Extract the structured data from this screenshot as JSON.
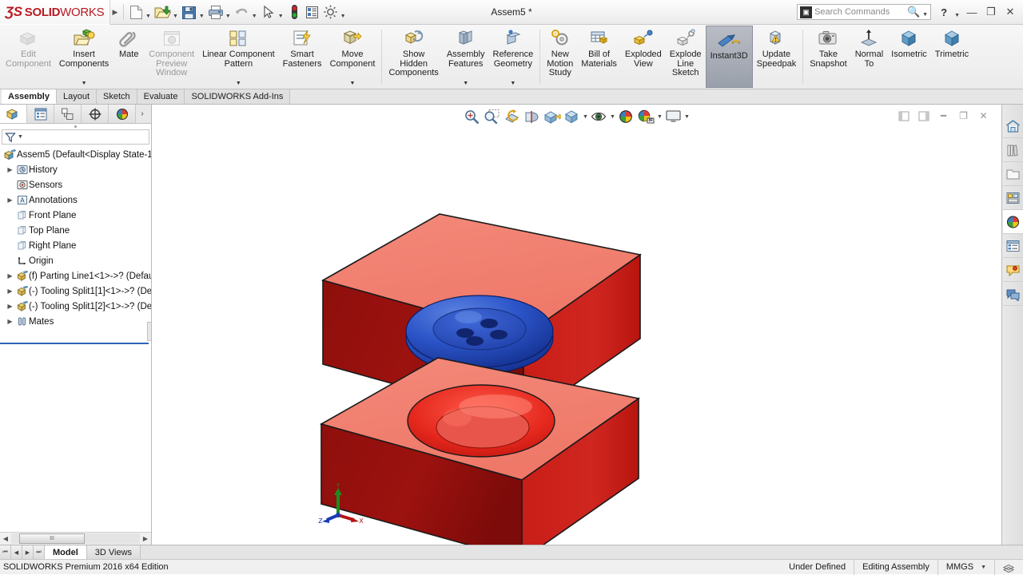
{
  "titlebar": {
    "logo_ds": "ƷS",
    "logo_bold": "SOLID",
    "logo_light": "WORKS",
    "document_title": "Assem5 *",
    "quick_access": [
      {
        "name": "new-document",
        "label": "New",
        "icon": "page-icon"
      },
      {
        "name": "open-document",
        "label": "Open",
        "icon": "folder-open-icon"
      },
      {
        "name": "save-document",
        "label": "Save",
        "icon": "floppy-disk-icon"
      },
      {
        "name": "print-document",
        "label": "Print",
        "icon": "printer-icon"
      },
      {
        "name": "undo",
        "label": "Undo",
        "icon": "undo-arrow-icon"
      },
      {
        "name": "select",
        "label": "Select",
        "icon": "cursor-arrow-icon"
      },
      {
        "name": "rebuild",
        "label": "Rebuild",
        "icon": "traffic-light-icon"
      },
      {
        "name": "options-display",
        "label": "File Properties",
        "icon": "properties-icon"
      },
      {
        "name": "options",
        "label": "Options",
        "icon": "gear-icon"
      }
    ],
    "search_placeholder": "Search Commands",
    "help_label": "?",
    "minimize_label": "—",
    "restore_label": "❐",
    "close_label": "✕"
  },
  "ribbon": {
    "groups": [
      {
        "items": [
          {
            "name": "edit-component",
            "label": "Edit\nComponent",
            "icon": "edit-component-icon",
            "disabled": true,
            "dropdown": false,
            "active": false
          },
          {
            "name": "insert-components",
            "label": "Insert\nComponents",
            "icon": "insert-components-icon",
            "disabled": false,
            "dropdown": true,
            "active": false
          },
          {
            "name": "mate",
            "label": "Mate",
            "icon": "paperclip-icon",
            "disabled": false,
            "dropdown": false,
            "active": false
          },
          {
            "name": "component-preview-window",
            "label": "Component\nPreview\nWindow",
            "icon": "preview-window-icon",
            "disabled": true,
            "dropdown": false,
            "active": false
          },
          {
            "name": "linear-component-pattern",
            "label": "Linear Component\nPattern",
            "icon": "linear-pattern-icon",
            "disabled": false,
            "dropdown": true,
            "active": false
          },
          {
            "name": "smart-fasteners",
            "label": "Smart\nFasteners",
            "icon": "smart-fasteners-icon",
            "disabled": false,
            "dropdown": false,
            "active": false
          },
          {
            "name": "move-component",
            "label": "Move\nComponent",
            "icon": "move-component-icon",
            "disabled": false,
            "dropdown": true,
            "active": false
          }
        ]
      },
      {
        "items": [
          {
            "name": "show-hidden-components",
            "label": "Show\nHidden\nComponents",
            "icon": "show-hidden-icon",
            "disabled": false,
            "dropdown": false,
            "active": false
          },
          {
            "name": "assembly-features",
            "label": "Assembly\nFeatures",
            "icon": "assembly-features-icon",
            "disabled": false,
            "dropdown": true,
            "active": false
          },
          {
            "name": "reference-geometry",
            "label": "Reference\nGeometry",
            "icon": "reference-geometry-icon",
            "disabled": false,
            "dropdown": true,
            "active": false
          }
        ]
      },
      {
        "items": [
          {
            "name": "new-motion-study",
            "label": "New\nMotion\nStudy",
            "icon": "motion-study-icon",
            "disabled": false,
            "dropdown": false,
            "active": false
          },
          {
            "name": "bill-of-materials",
            "label": "Bill of\nMaterials",
            "icon": "bom-icon",
            "disabled": false,
            "dropdown": false,
            "active": false
          },
          {
            "name": "exploded-view",
            "label": "Exploded\nView",
            "icon": "exploded-view-icon",
            "disabled": false,
            "dropdown": false,
            "active": false
          },
          {
            "name": "explode-line-sketch",
            "label": "Explode\nLine\nSketch",
            "icon": "explode-line-icon",
            "disabled": false,
            "dropdown": false,
            "active": false
          },
          {
            "name": "instant3d",
            "label": "Instant3D",
            "icon": "instant3d-icon",
            "disabled": false,
            "dropdown": false,
            "active": true
          },
          {
            "name": "update-speedpak",
            "label": "Update\nSpeedpak",
            "icon": "update-speedpak-icon",
            "disabled": false,
            "dropdown": false,
            "active": false
          }
        ]
      },
      {
        "items": [
          {
            "name": "take-snapshot",
            "label": "Take\nSnapshot",
            "icon": "camera-icon",
            "disabled": false,
            "dropdown": false,
            "active": false
          },
          {
            "name": "normal-to",
            "label": "Normal\nTo",
            "icon": "normal-to-icon",
            "disabled": false,
            "dropdown": false,
            "active": false
          },
          {
            "name": "isometric",
            "label": "Isometric",
            "icon": "cube-icon",
            "disabled": false,
            "dropdown": false,
            "active": false
          },
          {
            "name": "trimetric",
            "label": "Trimetric",
            "icon": "cube-icon",
            "disabled": false,
            "dropdown": false,
            "active": false
          }
        ]
      }
    ]
  },
  "command_tabs": [
    {
      "name": "tab-assembly",
      "label": "Assembly",
      "selected": true
    },
    {
      "name": "tab-layout",
      "label": "Layout",
      "selected": false
    },
    {
      "name": "tab-sketch",
      "label": "Sketch",
      "selected": false
    },
    {
      "name": "tab-evaluate",
      "label": "Evaluate",
      "selected": false
    },
    {
      "name": "tab-solidworks-addins",
      "label": "SOLIDWORKS Add-Ins",
      "selected": false
    }
  ],
  "feature_manager": {
    "tabs": [
      {
        "name": "featuremanager-design-tree-tab",
        "icon": "feature-tree-icon",
        "selected": true
      },
      {
        "name": "property-manager-tab",
        "icon": "property-manager-icon",
        "selected": false
      },
      {
        "name": "configuration-manager-tab",
        "icon": "configuration-manager-icon",
        "selected": false
      },
      {
        "name": "dimxpert-manager-tab",
        "icon": "dimxpert-icon",
        "selected": false
      },
      {
        "name": "display-manager-tab",
        "icon": "display-manager-icon",
        "selected": false
      }
    ],
    "more_tabs_label": "›",
    "filter_icon": "filter-icon",
    "tree": [
      {
        "name": "tree-item-assem5",
        "label": "Assem5  (Default<Display State-1",
        "icon": "assembly-icon",
        "expandable": false,
        "indent": 0
      },
      {
        "name": "tree-item-history",
        "label": "History",
        "icon": "history-icon",
        "expandable": true,
        "indent": 1
      },
      {
        "name": "tree-item-sensors",
        "label": "Sensors",
        "icon": "sensors-icon",
        "expandable": false,
        "indent": 1
      },
      {
        "name": "tree-item-annotations",
        "label": "Annotations",
        "icon": "annotations-icon",
        "expandable": true,
        "indent": 1
      },
      {
        "name": "tree-item-front-plane",
        "label": "Front Plane",
        "icon": "plane-icon",
        "expandable": false,
        "indent": 1
      },
      {
        "name": "tree-item-top-plane",
        "label": "Top Plane",
        "icon": "plane-icon",
        "expandable": false,
        "indent": 1
      },
      {
        "name": "tree-item-right-plane",
        "label": "Right Plane",
        "icon": "plane-icon",
        "expandable": false,
        "indent": 1
      },
      {
        "name": "tree-item-origin",
        "label": "Origin",
        "icon": "origin-icon",
        "expandable": false,
        "indent": 1
      },
      {
        "name": "tree-item-parting-line1",
        "label": "(f) Parting Line1<1>->? (Defau",
        "icon": "part-icon",
        "expandable": true,
        "indent": 1
      },
      {
        "name": "tree-item-tooling-split1-1",
        "label": "(-) Tooling Split1[1]<1>->? (De",
        "icon": "part-icon",
        "expandable": true,
        "indent": 1
      },
      {
        "name": "tree-item-tooling-split1-2",
        "label": "(-) Tooling Split1[2]<1>->? (De",
        "icon": "part-icon",
        "expandable": true,
        "indent": 1
      },
      {
        "name": "tree-item-mates",
        "label": "Mates",
        "icon": "mates-icon",
        "expandable": true,
        "indent": 1
      }
    ],
    "hscroll": {
      "left_arrow": "◀",
      "right_arrow": "▶",
      "thumb_grip": "III"
    }
  },
  "view_toolbar": {
    "buttons": [
      {
        "name": "zoom-to-fit-button",
        "icon": "zoom-to-fit-icon",
        "dropdown": false
      },
      {
        "name": "zoom-to-area-button",
        "icon": "zoom-to-area-icon",
        "dropdown": false
      },
      {
        "name": "previous-view-button",
        "icon": "previous-view-icon",
        "dropdown": false
      },
      {
        "name": "section-view-button",
        "icon": "section-view-icon",
        "dropdown": false
      },
      {
        "name": "view-orientation-button",
        "icon": "view-orientation-icon",
        "dropdown": false
      },
      {
        "name": "display-style-button",
        "icon": "display-style-icon",
        "dropdown": true
      },
      {
        "name": "view-settings-button",
        "icon": "view-settings-cube-icon",
        "dropdown": true
      },
      {
        "name": "hide-show-items-button",
        "icon": "eye-icon",
        "dropdown": true
      },
      {
        "name": "edit-appearance-button",
        "icon": "appearance-sphere-icon",
        "dropdown": false
      },
      {
        "name": "apply-scene-button",
        "icon": "scene-icon",
        "dropdown": true
      },
      {
        "name": "view-settings-display-button",
        "icon": "monitor-icon",
        "dropdown": true
      }
    ],
    "window_controls": [
      {
        "name": "restore-left-pane-button",
        "icon": "pane-left-icon"
      },
      {
        "name": "restore-right-pane-button",
        "icon": "pane-right-icon"
      },
      {
        "name": "minimize-document-button",
        "icon": "minimize-icon"
      },
      {
        "name": "restore-document-button",
        "icon": "restore-icon"
      },
      {
        "name": "close-document-button",
        "icon": "close-icon"
      }
    ]
  },
  "task_pane": [
    {
      "name": "solidworks-resources-button",
      "icon": "home-icon",
      "selected": false
    },
    {
      "name": "design-library-button",
      "icon": "design-library-icon",
      "selected": false
    },
    {
      "name": "file-explorer-button",
      "icon": "folder-icon",
      "selected": false
    },
    {
      "name": "view-palette-button",
      "icon": "view-palette-icon",
      "selected": false
    },
    {
      "name": "appearances-scenes-button",
      "icon": "appearance-sphere-icon",
      "selected": true
    },
    {
      "name": "custom-properties-button",
      "icon": "custom-properties-icon",
      "selected": false
    },
    {
      "name": "solidworks-forum-button",
      "icon": "forum-icon",
      "selected": false
    },
    {
      "name": "share-view-button",
      "icon": "share-icon",
      "selected": false
    }
  ],
  "model": {
    "triad": {
      "x_label": "X",
      "y_label": "Y",
      "z_label": "Z",
      "x_color": "#c00000",
      "y_color": "#008000",
      "z_color": "#0000c0"
    },
    "colors": {
      "block_top": "#f2806f",
      "block_left": "#8c0d0b",
      "block_right": "#c21a14",
      "cavity": "#e8332a",
      "button_blue": "#2b55c8",
      "button_blue_dark": "#16359a",
      "button_hole": "#11256e"
    },
    "parts": [
      {
        "name": "upper-mold-block",
        "label": "Tooling Split1[1]"
      },
      {
        "name": "button-part",
        "label": "Parting Line1"
      },
      {
        "name": "lower-mold-block",
        "label": "Tooling Split1[2]"
      }
    ]
  },
  "document_tabs": {
    "nav": [
      "⏮",
      "◀",
      "▶",
      "⏭"
    ],
    "tabs": [
      {
        "name": "doc-tab-model",
        "label": "Model",
        "selected": true
      },
      {
        "name": "doc-tab-3d-views",
        "label": "3D Views",
        "selected": false
      }
    ]
  },
  "status_bar": {
    "edition": "SOLIDWORKS Premium 2016 x64 Edition",
    "sketch_status": "Under Defined",
    "edit_mode": "Editing Assembly",
    "units": "MMGS",
    "units_caret": "▾",
    "overlay_icon": "overlay-icon"
  }
}
